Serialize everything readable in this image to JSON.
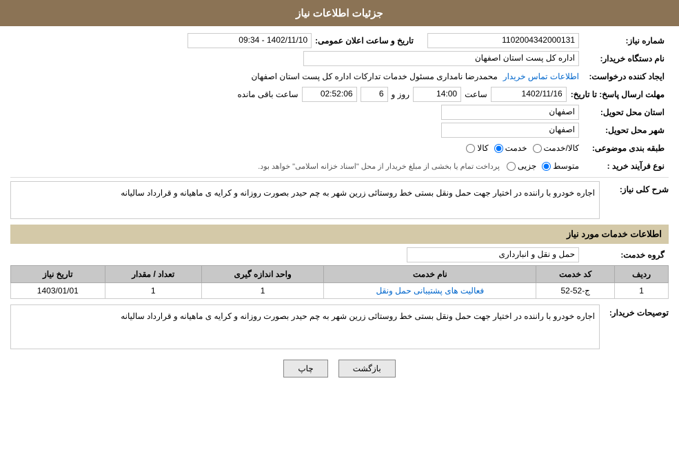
{
  "page": {
    "title": "جزئیات اطلاعات نیاز",
    "fields": {
      "need_number_label": "شماره نیاز:",
      "need_number_value": "1102004342000131",
      "buyer_org_label": "نام دستگاه خریدار:",
      "buyer_org_value": "اداره کل پست استان اصفهان",
      "creator_label": "ایجاد کننده درخواست:",
      "creator_value": "محمدرضا نامداری مسئول خدمات تداركات اداره كل پست استان اصفهان",
      "creator_link": "اطلاعات تماس خریدار",
      "deadline_label": "مهلت ارسال پاسخ: تا تاریخ:",
      "deadline_date": "1402/11/16",
      "deadline_time_label": "ساعت",
      "deadline_time": "14:00",
      "deadline_day_label": "روز و",
      "deadline_days": "6",
      "deadline_remaining_label": "ساعت باقی مانده",
      "deadline_remaining": "02:52:06",
      "announce_label": "تاریخ و ساعت اعلان عمومی:",
      "announce_value": "1402/11/10 - 09:34",
      "province_label": "استان محل تحویل:",
      "province_value": "اصفهان",
      "city_label": "شهر محل تحویل:",
      "city_value": "اصفهان",
      "category_label": "طبقه بندی موضوعی:",
      "category_options": [
        {
          "label": "کالا",
          "selected": false
        },
        {
          "label": "خدمت",
          "selected": true
        },
        {
          "label": "کالا/خدمت",
          "selected": false
        }
      ],
      "purchase_type_label": "نوع فرآیند خرید :",
      "purchase_type_options": [
        {
          "label": "جزیی",
          "selected": false
        },
        {
          "label": "متوسط",
          "selected": true
        }
      ],
      "purchase_type_note": "پرداخت تمام یا بخشی از مبلغ خریدار از محل \"اسناد خزانه اسلامی\" خواهد بود.",
      "need_desc_label": "شرح کلی نیاز:",
      "need_desc_value": "اجاره خودرو با راننده در اختیار جهت حمل ونقل بستی خط روستائی زرین شهر به چم حیدر بصورت روزانه و کرایه ی ماهیانه و قرارداد سالیانه",
      "services_title": "اطلاعات خدمات مورد نیاز",
      "service_group_label": "گروه خدمت:",
      "service_group_value": "حمل و نقل و انبارداری",
      "table": {
        "col_row": "ردیف",
        "col_code": "کد خدمت",
        "col_name": "نام خدمت",
        "col_unit": "واحد اندازه گیری",
        "col_qty": "تعداد / مقدار",
        "col_date": "تاریخ نیاز",
        "rows": [
          {
            "row": "1",
            "code": "ج-52-52",
            "name": "فعالیت های پشتیبانی حمل ونقل",
            "unit": "1",
            "qty": "1",
            "date": "1403/01/01"
          }
        ]
      },
      "buyer_notes_label": "توصیحات خریدار:",
      "buyer_notes_value": "اجاره خودرو با راننده در اختیار جهت حمل ونقل بستی خط روستائی زرین شهر به چم حیدر بصورت روزانه و کرایه ی ماهیانه و قرارداد سالیانه"
    },
    "buttons": {
      "print": "چاپ",
      "back": "بازگشت"
    }
  }
}
